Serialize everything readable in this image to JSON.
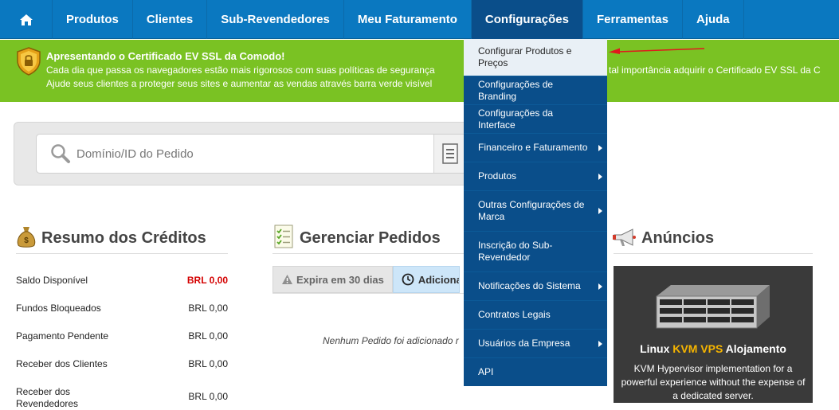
{
  "nav": {
    "items": [
      {
        "label": "Produtos"
      },
      {
        "label": "Clientes"
      },
      {
        "label": "Sub-Revendedores"
      },
      {
        "label": "Meu Faturamento"
      },
      {
        "label": "Configurações"
      },
      {
        "label": "Ferramentas"
      },
      {
        "label": "Ajuda"
      }
    ]
  },
  "banner": {
    "title": "Apresentando o Certificado EV SSL da Comodo!",
    "line1_left": "Cada dia que passa os navegadores estão mais rigorosos com suas políticas de segurança",
    "line1_right": "tal importância adquirir o Certificado EV SSL da C",
    "line2_left": "Ajude seus clientes a proteger seus sites e aumentar as vendas através barra verde visível"
  },
  "search": {
    "placeholder": "Domínio/ID do Pedido"
  },
  "credits": {
    "title": "Resumo dos Créditos",
    "rows": [
      {
        "label": "Saldo Disponível",
        "value": "BRL 0,00"
      },
      {
        "label": "Fundos Bloqueados",
        "value": "BRL 0,00"
      },
      {
        "label": "Pagamento Pendente",
        "value": "BRL 0,00"
      },
      {
        "label": "Receber dos Clientes",
        "value": "BRL 0,00"
      },
      {
        "label": "Receber dos Revendedores",
        "value": "BRL 0,00"
      }
    ]
  },
  "orders": {
    "title": "Gerenciar Pedidos",
    "tab_expiring": "Expira em 30 dias",
    "tab_added": "Adicionados",
    "empty_message": "Nenhum Pedido foi adicionado r"
  },
  "announcements": {
    "title": "Anúncios",
    "ad_title_pre": "Linux ",
    "ad_title_hl": "KVM VPS",
    "ad_title_post": " Alojamento",
    "ad_text": "KVM Hypervisor implementation for a powerful experience without the expense of a dedicated server."
  },
  "dropdown": {
    "items": [
      {
        "label": "Configurar Produtos e Preços"
      },
      {
        "label": "Configurações de Branding"
      },
      {
        "label": "Configurações da Interface"
      },
      {
        "label": "Financeiro e Faturamento"
      },
      {
        "label": "Produtos"
      },
      {
        "label": "Outras Configurações de Marca"
      },
      {
        "label": "Inscrição do Sub-Revendedor"
      },
      {
        "label": "Notificações do Sistema"
      },
      {
        "label": "Contratos Legais"
      },
      {
        "label": "Usuários da Empresa"
      },
      {
        "label": "API"
      }
    ]
  },
  "colors": {
    "nav_blue": "#0a78c0",
    "nav_active": "#0a4e8a",
    "banner_green": "#7ac223",
    "alert_red": "#d40000",
    "highlight_orange": "#f6b500",
    "annotation_arrow": "#e0191d"
  },
  "icons": {
    "home": "home-icon",
    "shield": "shield-icon",
    "search": "search-icon",
    "moneybag": "money-bag-icon",
    "checklist": "checklist-icon",
    "megaphone": "megaphone-icon",
    "warning": "warning-icon",
    "clock": "clock-icon",
    "submenu": "chevron-right-icon"
  }
}
